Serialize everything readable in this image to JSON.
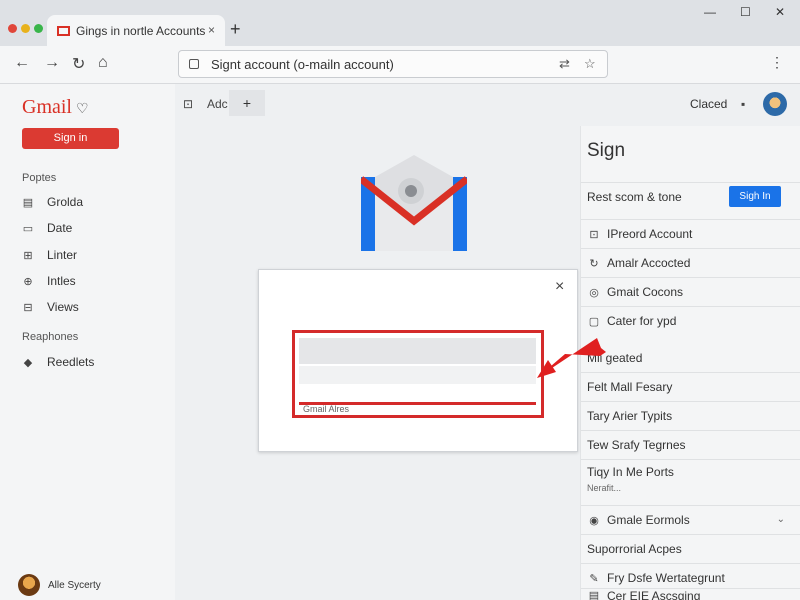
{
  "browser": {
    "tab_title": "Gings in nortle Accounts",
    "tab_close": "×",
    "new_tab": "+",
    "address": "Signt account (o-mailn account)",
    "window_controls": [
      "—",
      "☐",
      "✕"
    ]
  },
  "sidebar": {
    "logo": "Gmail",
    "logo_mark": "♡",
    "signin_label": "Sign in",
    "section1": "Poptes",
    "items": [
      {
        "icon": "list-icon",
        "glyph": "▤",
        "label": "Grolda"
      },
      {
        "icon": "calendar-icon",
        "glyph": "▭",
        "label": "Date"
      },
      {
        "icon": "filter-icon",
        "glyph": "⊞",
        "label": "Linter"
      },
      {
        "icon": "globe-icon",
        "glyph": "⊕",
        "label": "Intles"
      },
      {
        "icon": "grid-icon",
        "glyph": "⊟",
        "label": "Views"
      }
    ],
    "section2": "Reaphones",
    "items2": [
      {
        "icon": "bell-icon",
        "glyph": "◆",
        "label": "Reedlets"
      }
    ],
    "user_label": "Alle Sycerty"
  },
  "topbar": {
    "add_label": "Adc",
    "plus": "+",
    "closed_label": "Claced"
  },
  "right_panel": {
    "title": "Sign",
    "header_row": "Rest scom & tone",
    "sign_button": "Sigh In",
    "rows": [
      {
        "icon": "doc-icon",
        "glyph": "⊡",
        "label": "IPreord Account"
      },
      {
        "icon": "refresh-icon",
        "glyph": "↻",
        "label": "Amalr Accocted"
      },
      {
        "icon": "gmail-icon",
        "glyph": "◎",
        "label": "Gmait Cocons"
      },
      {
        "icon": "file-icon",
        "glyph": "▢",
        "label": "Cater for ypd"
      }
    ],
    "plain_rows": [
      "Mli geated",
      "Felt Mall Fesary",
      "Tary Arier Typits",
      "Tew Srafy Tegrnes",
      "Tiqy In Me Ports"
    ],
    "sub_text": "Nerafit...",
    "lower_rows": [
      {
        "icon": "gmail-icon",
        "glyph": "◉",
        "label": "Gmale Eormols"
      },
      {
        "icon": "",
        "glyph": "",
        "label": "Suporrorial Acpes"
      },
      {
        "icon": "pen-icon",
        "glyph": "✎",
        "label": "Fry Dsfe Wertategrunt"
      },
      {
        "icon": "doc-icon",
        "glyph": "▤",
        "label": "Cer EIE Ascsging"
      }
    ]
  },
  "modal": {
    "close": "×",
    "field_label": "Gmail Alres"
  },
  "colors": {
    "gmail_red": "#d93025",
    "highlight_red": "#d42a2a",
    "signin_blue": "#1a73e8"
  }
}
